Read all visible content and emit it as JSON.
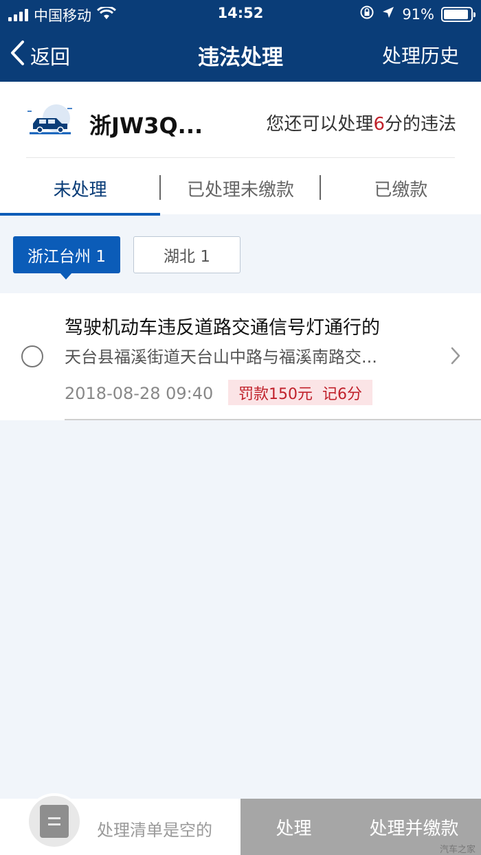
{
  "status_bar": {
    "carrier": "中国移动",
    "time": "14:52",
    "battery": "91%",
    "battery_level": 0.91
  },
  "nav": {
    "back_label": "返回",
    "title": "违法处理",
    "history_label": "处理历史"
  },
  "vehicle": {
    "plate": "浙JW3Q...",
    "points_prefix": "您还可以处理",
    "points_value": "6",
    "points_suffix": "分的违法"
  },
  "tabs": [
    {
      "label": "未处理",
      "active": true
    },
    {
      "label": "已处理未缴款",
      "active": false
    },
    {
      "label": "已缴款",
      "active": false
    }
  ],
  "regions": [
    {
      "label": "浙江台州 1",
      "active": true
    },
    {
      "label": "湖北 1",
      "active": false
    }
  ],
  "violation": {
    "title": "驾驶机动车违反道路交通信号灯通行的",
    "location": "天台县福溪街道天台山中路与福溪南路交...",
    "datetime": "2018-08-28 09:40",
    "fine": "罚款150元",
    "points": "记6分"
  },
  "bottom_bar": {
    "empty_text": "处理清单是空的",
    "process_label": "处理",
    "process_pay_label": "处理并缴款"
  },
  "watermark": "汽车之家",
  "colors": {
    "nav_bg": "#0a3d78",
    "accent": "#0b5cb8",
    "penalty_text": "#c0212b",
    "penalty_bg": "#fbe4e6",
    "disabled_button": "#a6a6a6"
  }
}
